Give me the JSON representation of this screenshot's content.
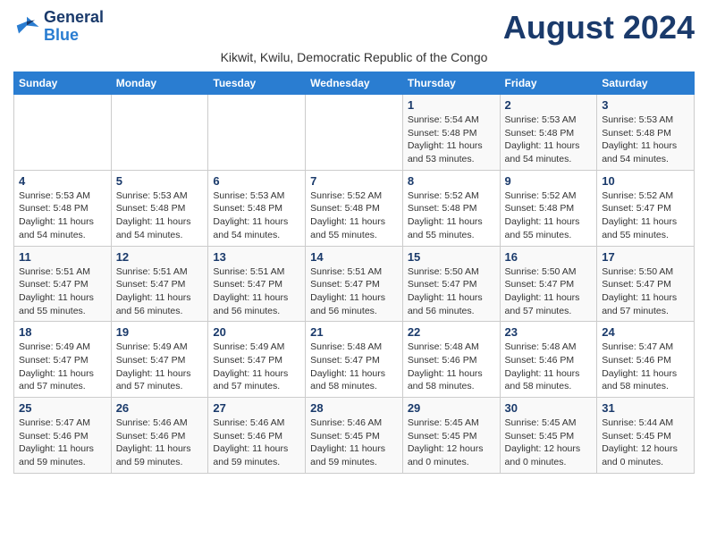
{
  "logo": {
    "line1": "General",
    "line2": "Blue"
  },
  "title": "August 2024",
  "subtitle": "Kikwit, Kwilu, Democratic Republic of the Congo",
  "headers": [
    "Sunday",
    "Monday",
    "Tuesday",
    "Wednesday",
    "Thursday",
    "Friday",
    "Saturday"
  ],
  "weeks": [
    [
      {
        "day": "",
        "info": ""
      },
      {
        "day": "",
        "info": ""
      },
      {
        "day": "",
        "info": ""
      },
      {
        "day": "",
        "info": ""
      },
      {
        "day": "1",
        "sunrise": "5:54 AM",
        "sunset": "5:48 PM",
        "daylight": "11 hours and 53 minutes."
      },
      {
        "day": "2",
        "sunrise": "5:53 AM",
        "sunset": "5:48 PM",
        "daylight": "11 hours and 54 minutes."
      },
      {
        "day": "3",
        "sunrise": "5:53 AM",
        "sunset": "5:48 PM",
        "daylight": "11 hours and 54 minutes."
      }
    ],
    [
      {
        "day": "4",
        "sunrise": "5:53 AM",
        "sunset": "5:48 PM",
        "daylight": "11 hours and 54 minutes."
      },
      {
        "day": "5",
        "sunrise": "5:53 AM",
        "sunset": "5:48 PM",
        "daylight": "11 hours and 54 minutes."
      },
      {
        "day": "6",
        "sunrise": "5:53 AM",
        "sunset": "5:48 PM",
        "daylight": "11 hours and 54 minutes."
      },
      {
        "day": "7",
        "sunrise": "5:52 AM",
        "sunset": "5:48 PM",
        "daylight": "11 hours and 55 minutes."
      },
      {
        "day": "8",
        "sunrise": "5:52 AM",
        "sunset": "5:48 PM",
        "daylight": "11 hours and 55 minutes."
      },
      {
        "day": "9",
        "sunrise": "5:52 AM",
        "sunset": "5:48 PM",
        "daylight": "11 hours and 55 minutes."
      },
      {
        "day": "10",
        "sunrise": "5:52 AM",
        "sunset": "5:47 PM",
        "daylight": "11 hours and 55 minutes."
      }
    ],
    [
      {
        "day": "11",
        "sunrise": "5:51 AM",
        "sunset": "5:47 PM",
        "daylight": "11 hours and 55 minutes."
      },
      {
        "day": "12",
        "sunrise": "5:51 AM",
        "sunset": "5:47 PM",
        "daylight": "11 hours and 56 minutes."
      },
      {
        "day": "13",
        "sunrise": "5:51 AM",
        "sunset": "5:47 PM",
        "daylight": "11 hours and 56 minutes."
      },
      {
        "day": "14",
        "sunrise": "5:51 AM",
        "sunset": "5:47 PM",
        "daylight": "11 hours and 56 minutes."
      },
      {
        "day": "15",
        "sunrise": "5:50 AM",
        "sunset": "5:47 PM",
        "daylight": "11 hours and 56 minutes."
      },
      {
        "day": "16",
        "sunrise": "5:50 AM",
        "sunset": "5:47 PM",
        "daylight": "11 hours and 57 minutes."
      },
      {
        "day": "17",
        "sunrise": "5:50 AM",
        "sunset": "5:47 PM",
        "daylight": "11 hours and 57 minutes."
      }
    ],
    [
      {
        "day": "18",
        "sunrise": "5:49 AM",
        "sunset": "5:47 PM",
        "daylight": "11 hours and 57 minutes."
      },
      {
        "day": "19",
        "sunrise": "5:49 AM",
        "sunset": "5:47 PM",
        "daylight": "11 hours and 57 minutes."
      },
      {
        "day": "20",
        "sunrise": "5:49 AM",
        "sunset": "5:47 PM",
        "daylight": "11 hours and 57 minutes."
      },
      {
        "day": "21",
        "sunrise": "5:48 AM",
        "sunset": "5:47 PM",
        "daylight": "11 hours and 58 minutes."
      },
      {
        "day": "22",
        "sunrise": "5:48 AM",
        "sunset": "5:46 PM",
        "daylight": "11 hours and 58 minutes."
      },
      {
        "day": "23",
        "sunrise": "5:48 AM",
        "sunset": "5:46 PM",
        "daylight": "11 hours and 58 minutes."
      },
      {
        "day": "24",
        "sunrise": "5:47 AM",
        "sunset": "5:46 PM",
        "daylight": "11 hours and 58 minutes."
      }
    ],
    [
      {
        "day": "25",
        "sunrise": "5:47 AM",
        "sunset": "5:46 PM",
        "daylight": "11 hours and 59 minutes."
      },
      {
        "day": "26",
        "sunrise": "5:46 AM",
        "sunset": "5:46 PM",
        "daylight": "11 hours and 59 minutes."
      },
      {
        "day": "27",
        "sunrise": "5:46 AM",
        "sunset": "5:46 PM",
        "daylight": "11 hours and 59 minutes."
      },
      {
        "day": "28",
        "sunrise": "5:46 AM",
        "sunset": "5:45 PM",
        "daylight": "11 hours and 59 minutes."
      },
      {
        "day": "29",
        "sunrise": "5:45 AM",
        "sunset": "5:45 PM",
        "daylight": "12 hours and 0 minutes."
      },
      {
        "day": "30",
        "sunrise": "5:45 AM",
        "sunset": "5:45 PM",
        "daylight": "12 hours and 0 minutes."
      },
      {
        "day": "31",
        "sunrise": "5:44 AM",
        "sunset": "5:45 PM",
        "daylight": "12 hours and 0 minutes."
      }
    ]
  ]
}
